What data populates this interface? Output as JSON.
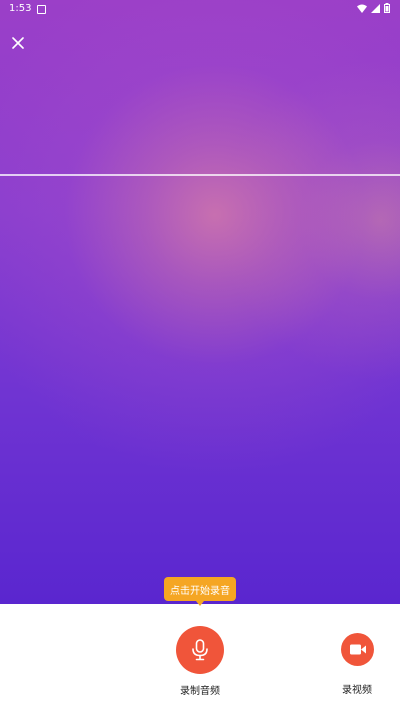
{
  "status_bar": {
    "time": "1:53",
    "icons": [
      "notification-icon",
      "wifi-icon",
      "signal-icon",
      "battery-icon"
    ]
  },
  "toolbar": {
    "close_icon": "close-icon"
  },
  "prompt": {
    "tooltip_text": "点击开始录音"
  },
  "actions": {
    "record_audio_label": "录制音频",
    "record_video_label": "录视频"
  },
  "colors": {
    "accent": "#f0553a",
    "tooltip": "#f5a623",
    "background_top": "#9b3fc8",
    "background_bottom": "#5a26cf"
  }
}
